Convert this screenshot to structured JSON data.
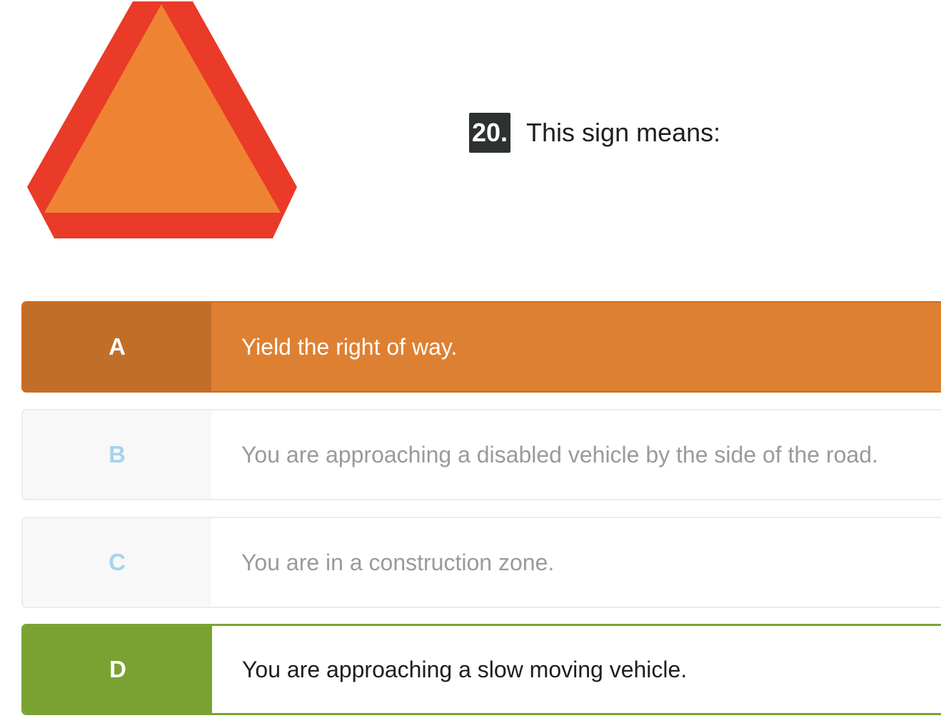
{
  "sign": {
    "icon": "slow-moving-vehicle-sign-icon",
    "outer_color": "#ea3a28",
    "inner_color": "#ee8433"
  },
  "question": {
    "number": "20.",
    "text": "This sign means:"
  },
  "options": [
    {
      "letter": "A",
      "text": "Yield the right of way.",
      "state": "selected-incorrect",
      "color": "#de8032"
    },
    {
      "letter": "B",
      "text": "You are approaching a disabled vehicle by the side of the road.",
      "state": "unselected"
    },
    {
      "letter": "C",
      "text": "You are in a construction zone.",
      "state": "unselected"
    },
    {
      "letter": "D",
      "text": "You are approaching a slow moving vehicle.",
      "state": "correct",
      "color": "#7aa232"
    }
  ]
}
